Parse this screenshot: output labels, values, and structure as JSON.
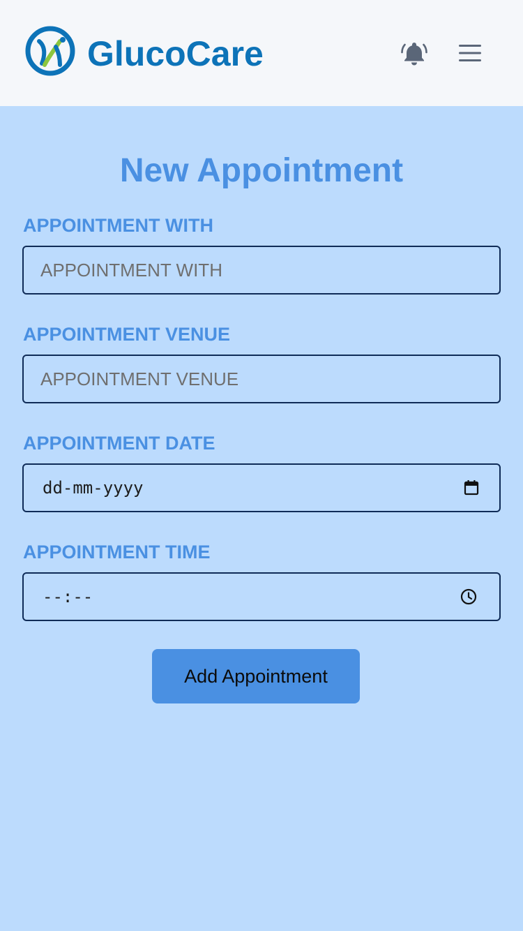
{
  "header": {
    "brand_name": "GlucoCare",
    "logo_icon": "glucocare-logo",
    "notification_icon": "bell-icon",
    "menu_icon": "hamburger-menu-icon"
  },
  "form": {
    "title": "New Appointment",
    "fields": [
      {
        "label": "APPOINTMENT WITH",
        "placeholder": "APPOINTMENT WITH",
        "value": ""
      },
      {
        "label": "APPOINTMENT VENUE",
        "placeholder": "APPOINTMENT VENUE",
        "value": ""
      },
      {
        "label": "APPOINTMENT DATE",
        "display_value": "dd-mm-yyyy",
        "icon": "calendar-icon"
      },
      {
        "label": "APPOINTMENT TIME",
        "display_value": "--:--",
        "icon": "clock-icon"
      }
    ],
    "submit_label": "Add Appointment"
  },
  "colors": {
    "header_bg": "#f5f7fa",
    "page_bg": "#bcdbfd",
    "brand": "#0d73b8",
    "accent": "#4a90e2",
    "field_border": "#0f2b57",
    "icon_gray": "#5a6678"
  }
}
